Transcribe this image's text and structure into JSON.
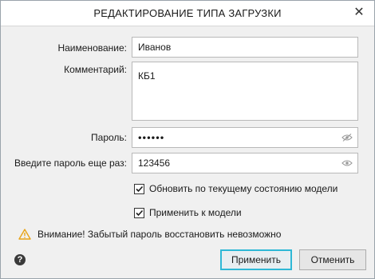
{
  "dialog": {
    "title": "РЕДАКТИРОВАНИЕ ТИПА ЗАГРУЗКИ",
    "close_glyph": "✕"
  },
  "form": {
    "name_label": "Наименование:",
    "name_value": "Иванов",
    "comment_label": "Комментарий:",
    "comment_value": "КБ1",
    "password_label": "Пароль:",
    "password_value": "••••••",
    "password_repeat_label": "Введите пароль еще раз:",
    "password_repeat_value": "123456"
  },
  "options": {
    "update_by_state_label": "Обновить по текущему состоянию модели",
    "update_by_state_checked": true,
    "apply_to_model_label": "Применить к модели",
    "apply_to_model_checked": true
  },
  "warning": {
    "text": "Внимание! Забытый пароль восстановить невозможно",
    "icon": "warning-triangle-icon",
    "color": "#e8a317"
  },
  "footer": {
    "help_glyph": "?",
    "apply_label": "Применить",
    "cancel_label": "Отменить",
    "accent_color": "#2fb8d6"
  }
}
